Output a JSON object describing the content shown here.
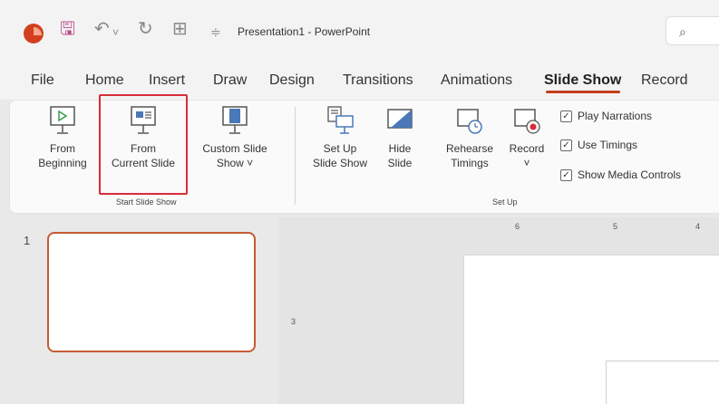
{
  "titlebar": {
    "doc_title": "Presentation1 - PowerPoint",
    "save_icon": "save-icon",
    "undo_icon": "undo-icon",
    "redo_icon": "redo-icon",
    "present_icon": "present-icon",
    "customize_icon": "customize-qat-icon",
    "search_icon": "search-icon"
  },
  "tabs": [
    "File",
    "Home",
    "Insert",
    "Draw",
    "Design",
    "Transitions",
    "Animations",
    "Slide Show",
    "Record"
  ],
  "active_tab": "Slide Show",
  "ribbon": {
    "from_beginning": {
      "line1": "From",
      "line2": "Beginning"
    },
    "from_current": {
      "line1": "From",
      "line2": "Current Slide"
    },
    "custom_show": {
      "line1": "Custom Slide",
      "line2": "Show ˅"
    },
    "start_group": "Start Slide Show",
    "setup_show": {
      "line1": "Set Up",
      "line2": "Slide Show"
    },
    "hide_slide": {
      "line1": "Hide",
      "line2": "Slide"
    },
    "rehearse": {
      "line1": "Rehearse",
      "line2": "Timings"
    },
    "record": {
      "line1": "Record",
      "line2": "˅"
    },
    "play_narrations": "Play Narrations",
    "use_timings": "Use Timings",
    "show_media_controls": "Show Media Controls",
    "setup_group": "Set Up"
  },
  "thumbnails": {
    "slide_number": "1"
  },
  "rulers": {
    "h_ticks": [
      "6",
      "5",
      "4"
    ],
    "v_ticks": [
      "3"
    ]
  },
  "colors": {
    "accent": "#c43e1c",
    "highlight": "#d92b3a",
    "logo": "#d2401f"
  }
}
